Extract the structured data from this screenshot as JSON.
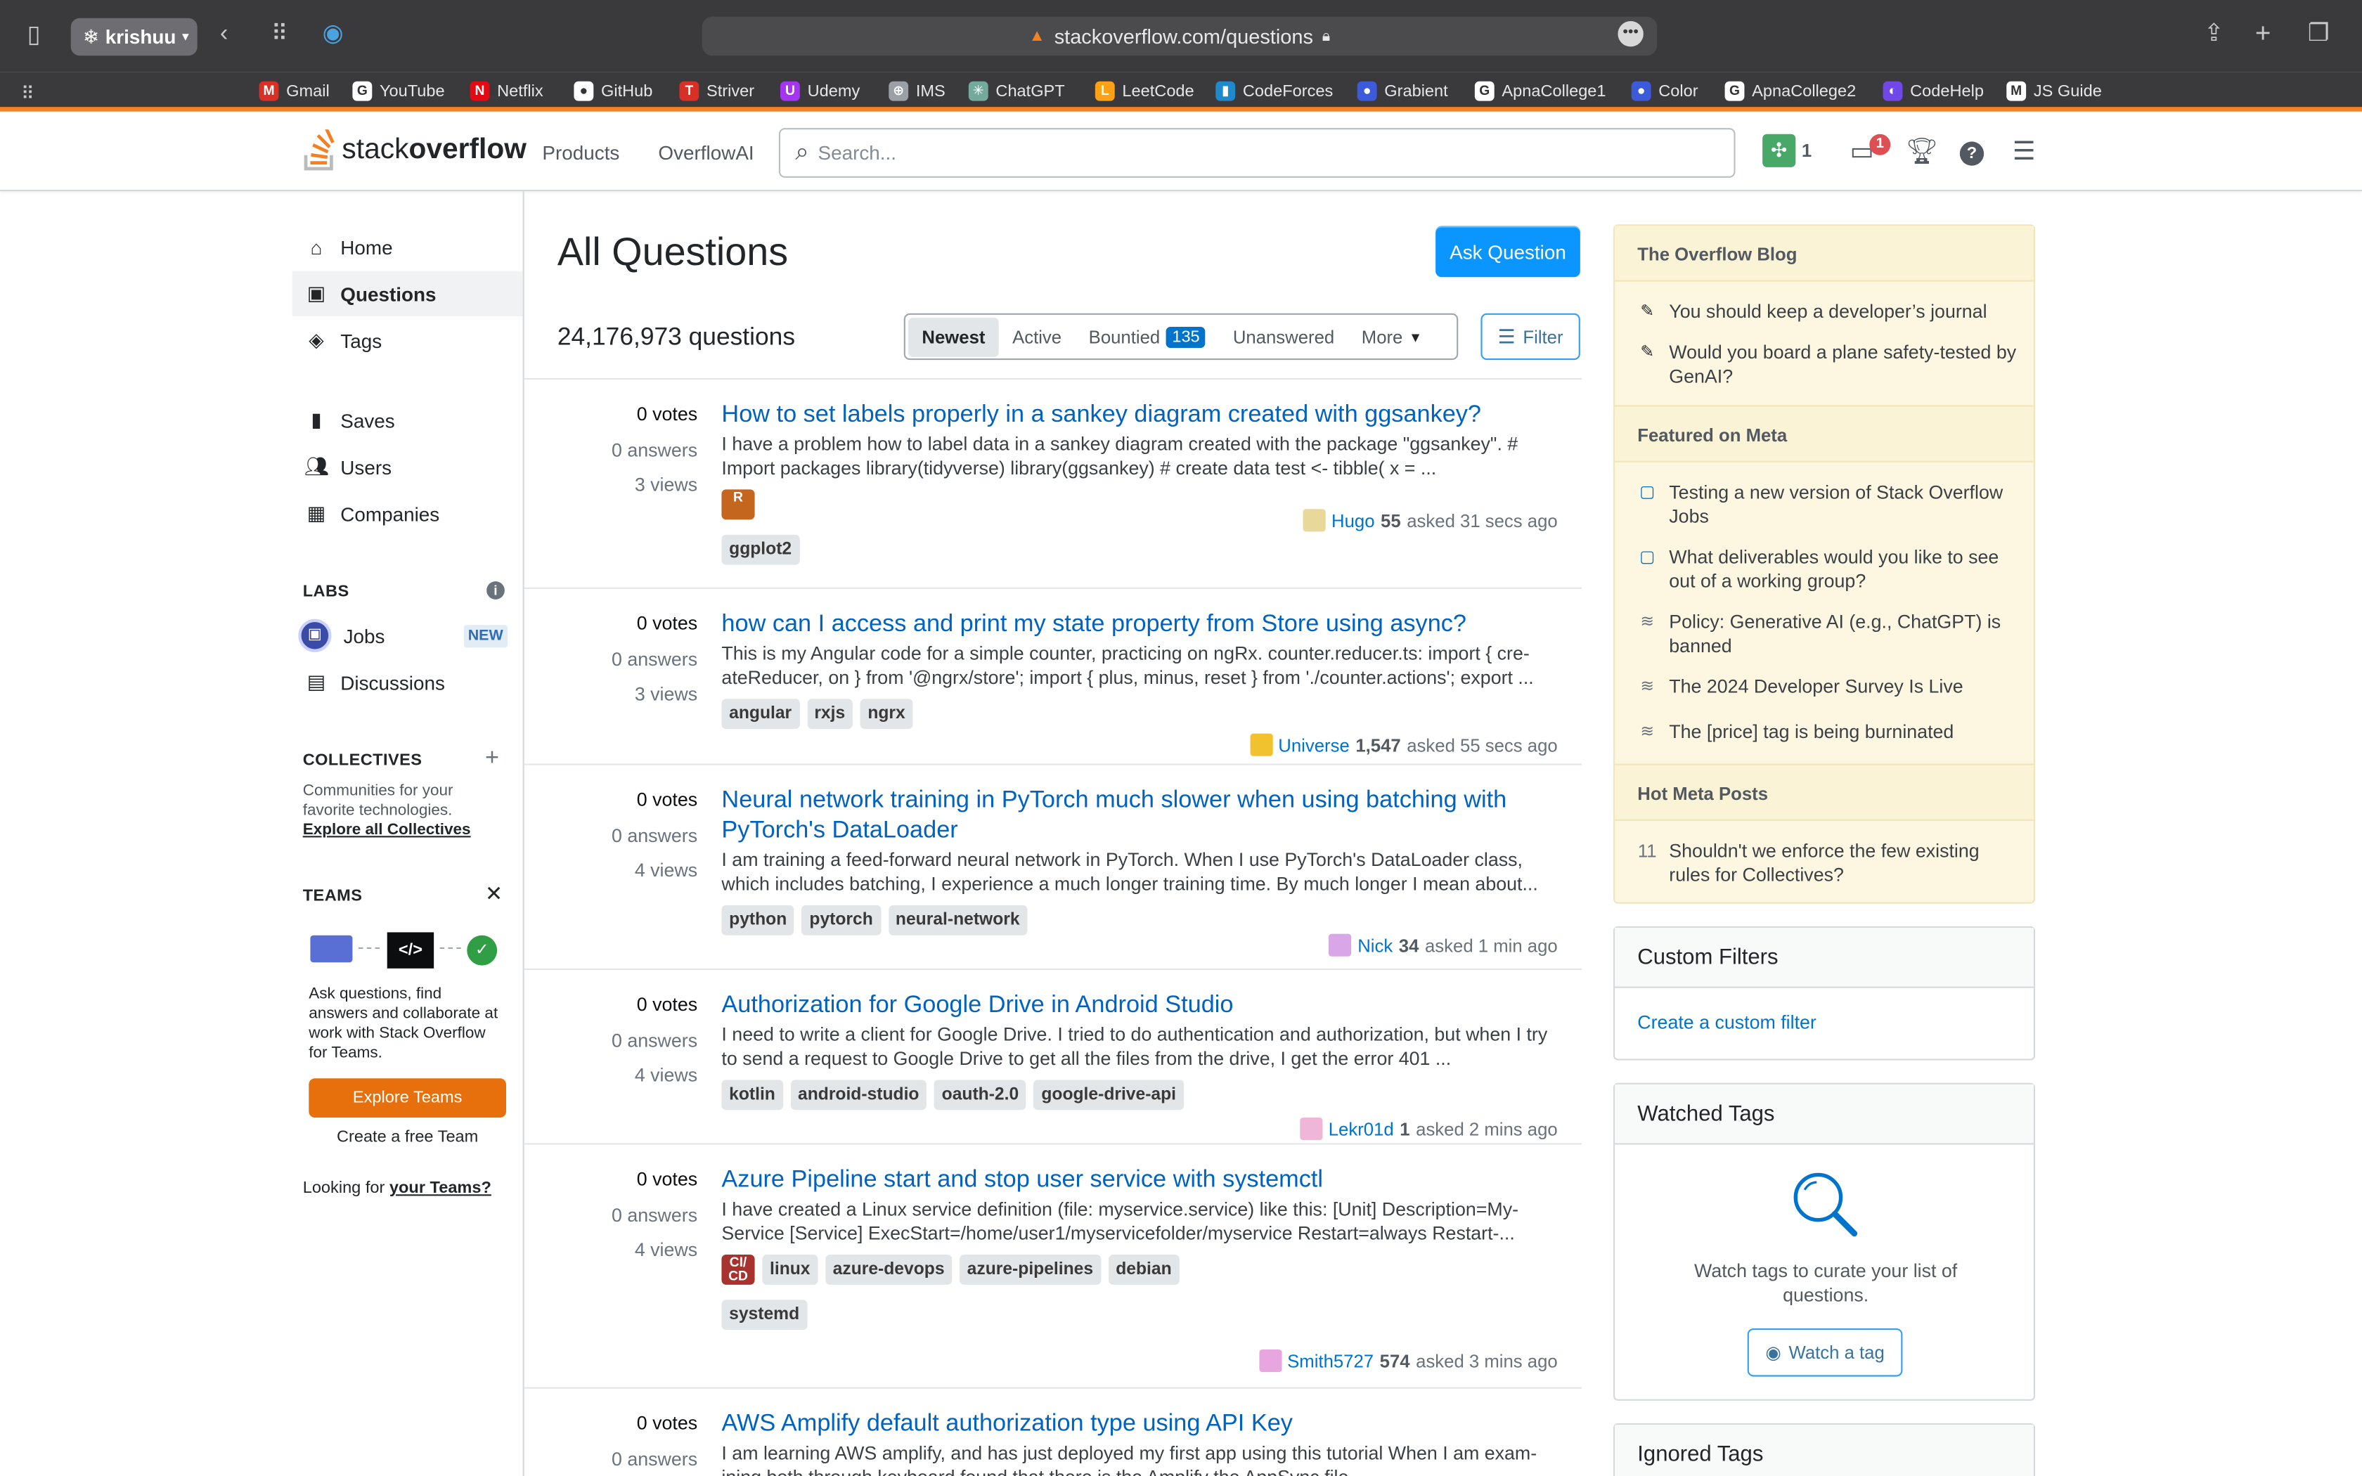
{
  "browser": {
    "profile": "krishuu",
    "url": "stackoverflow.com/questions",
    "bookmarks": [
      {
        "label": "Gmail",
        "color": "#d93025",
        "glyph": "M"
      },
      {
        "label": "YouTube",
        "color": "#ffffff",
        "glyph": "G"
      },
      {
        "label": "Netflix",
        "color": "#e50914",
        "glyph": "N"
      },
      {
        "label": "GitHub",
        "color": "#ffffff",
        "glyph": "●"
      },
      {
        "label": "Striver",
        "color": "#d93025",
        "glyph": "T"
      },
      {
        "label": "Udemy",
        "color": "#a435f0",
        "glyph": "U"
      },
      {
        "label": "IMS",
        "color": "#9aa0a6",
        "glyph": "⊕"
      },
      {
        "label": "ChatGPT",
        "color": "#74aa9c",
        "glyph": "✳"
      },
      {
        "label": "LeetCode",
        "color": "#ffa116",
        "glyph": "L"
      },
      {
        "label": "CodeForces",
        "color": "#1f8acb",
        "glyph": "▮"
      },
      {
        "label": "Grabient",
        "color": "#3b5bdb",
        "glyph": "●"
      },
      {
        "label": "ApnaCollege1",
        "color": "#ffffff",
        "glyph": "G"
      },
      {
        "label": "Color",
        "color": "#3b5bdb",
        "glyph": "●"
      },
      {
        "label": "ApnaCollege2",
        "color": "#ffffff",
        "glyph": "G"
      },
      {
        "label": "CodeHelp",
        "color": "#7048e8",
        "glyph": "◐"
      },
      {
        "label": "JS Guide",
        "color": "#ffffff",
        "glyph": "M"
      }
    ]
  },
  "header": {
    "logo_light": "stack",
    "logo_bold": "overflow",
    "nav": [
      "Products",
      "OverflowAI"
    ],
    "search_placeholder": "Search...",
    "reputation": "1",
    "inbox_count": "1"
  },
  "sidebar": {
    "items": [
      {
        "label": "Home",
        "icon": "home-icon"
      },
      {
        "label": "Questions",
        "icon": "questions-icon"
      },
      {
        "label": "Tags",
        "icon": "tag-icon"
      },
      {
        "label": "Saves",
        "icon": "bookmark-icon"
      },
      {
        "label": "Users",
        "icon": "users-icon"
      },
      {
        "label": "Companies",
        "icon": "companies-icon"
      }
    ],
    "labs_title": "LABS",
    "labs_items": [
      {
        "label": "Jobs",
        "badge": "NEW"
      },
      {
        "label": "Discussions"
      }
    ],
    "collectives_title": "COLLECTIVES",
    "collectives_desc": "Communities for your favorite technologies.",
    "collectives_link": "Explore all Collectives",
    "teams_title": "TEAMS",
    "teams_desc": "Ask questions, find answers and collaborate at work with Stack Overflow for Teams.",
    "teams_btn": "Explore Teams",
    "teams_free": "Create a free Team",
    "teams_looking": "Looking for",
    "teams_link": "your Teams?"
  },
  "main": {
    "title": "All Questions",
    "ask_button": "Ask Question",
    "question_count": "24,176,973 questions",
    "tabs": [
      {
        "label": "Newest"
      },
      {
        "label": "Active"
      },
      {
        "label": "Bountied",
        "badge": "135"
      },
      {
        "label": "Unanswered"
      },
      {
        "label": "More"
      }
    ],
    "filter": "Filter",
    "questions": [
      {
        "votes": "0",
        "votes_label": "votes",
        "answers": "0 answers",
        "views": "3 views",
        "title": "How to set labels properly in a sankey diagram created with ggsankey?",
        "excerpt": "I have a problem how to label data in a sankey diagram created with the package \"ggsankey\". # Import packages library(tidyverse) library(ggsankey) # create data test <- tibble( x = ...",
        "collective": "R",
        "collective_color": "#c5661f",
        "tags": [
          "ggplot2"
        ],
        "user": "Hugo",
        "rep": "55",
        "time": "asked 31 secs ago",
        "avatar_color": "#e8d89a"
      },
      {
        "votes": "0",
        "votes_label": "votes",
        "answers": "0 answers",
        "views": "3 views",
        "title": "how can I access and print my state property from Store using async?",
        "excerpt": "This is my Angular code for a simple counter, practicing on ngRx. counter.reducer.ts: import { cre-ateReducer, on } from '@ngrx/store'; import { plus, minus, reset } from './counter.actions'; export ...",
        "collective": "",
        "collective_color": "",
        "tags": [
          "angular",
          "rxjs",
          "ngrx"
        ],
        "user": "Universe",
        "rep": "1,547",
        "time": "asked 55 secs ago",
        "avatar_color": "#f2c12e"
      },
      {
        "votes": "0",
        "votes_label": "votes",
        "answers": "0 answers",
        "views": "4 views",
        "title": "Neural network training in PyTorch much slower when using batching with PyTorch's DataLoader",
        "excerpt": "I am training a feed-forward neural network in PyTorch. When I use PyTorch's DataLoader class, which includes batching, I experience a much longer training time. By much longer I mean about...",
        "collective": "",
        "collective_color": "",
        "tags": [
          "python",
          "pytorch",
          "neural-network"
        ],
        "user": "Nick",
        "rep": "34",
        "time": "asked 1 min ago",
        "avatar_color": "#d9a6e8"
      },
      {
        "votes": "0",
        "votes_label": "votes",
        "answers": "0 answers",
        "views": "4 views",
        "title": "Authorization for Google Drive in Android Studio",
        "excerpt": "I need to write a client for Google Drive. I tried to do authentication and authorization, but when I try to send a request to Google Drive to get all the files from the drive, I get the error 401 ...",
        "collective": "",
        "collective_color": "",
        "tags": [
          "kotlin",
          "android-studio",
          "oauth-2.0",
          "google-drive-api"
        ],
        "user": "Lekr01d",
        "rep": "1",
        "time": "asked 2 mins ago",
        "avatar_color": "#f0b6d8"
      },
      {
        "votes": "0",
        "votes_label": "votes",
        "answers": "0 answers",
        "views": "4 views",
        "title": "Azure Pipeline start and stop user service with systemctl",
        "excerpt": "I have created a Linux service definition (file: myservice.service) like this: [Unit] Description=My-Service [Service] ExecStart=/home/user1/myservicefolder/myservice Restart=always Restart-...",
        "collective": "CI/ CD",
        "collective_color": "#a8322e",
        "tags": [
          "linux",
          "azure-devops",
          "azure-pipelines",
          "debian",
          "systemd"
        ],
        "user": "Smith5727",
        "rep": "574",
        "time": "asked 3 mins ago",
        "avatar_color": "#e8a6e0"
      },
      {
        "votes": "0",
        "votes_label": "votes",
        "answers": "0 answers",
        "views": "",
        "title": "AWS Amplify default authorization type using API Key",
        "excerpt": "I am learning AWS amplify, and has just deployed my first app using this tutorial When I am exam-ining both through keyboard found that there is the Amplify the AppSync file",
        "collective": "",
        "collective_color": "",
        "tags": [],
        "user": "",
        "rep": "",
        "time": "",
        "avatar_color": ""
      }
    ]
  },
  "right": {
    "blog_title": "The Overflow Blog",
    "blog_items": [
      "You should keep a developer’s journal",
      "Would you board a plane safety-tested by GenAI?"
    ],
    "meta_title": "Featured on Meta",
    "meta_items": [
      "Testing a new version of Stack Overflow Jobs",
      "What deliverables would you like to see out of a working group?",
      "Policy: Generative AI (e.g., ChatGPT) is banned",
      "The 2024 Developer Survey Is Live",
      "The [price] tag is being burninated"
    ],
    "hot_title": "Hot Meta Posts",
    "hot_items": [
      {
        "count": "11",
        "text": "Shouldn't we enforce the few existing rules for Collectives?"
      }
    ],
    "custom_filters_title": "Custom Filters",
    "custom_filters_link": "Create a custom filter",
    "watched_title": "Watched Tags",
    "watched_text": "Watch tags to curate your list of questions.",
    "watched_btn": "Watch a tag",
    "ignored_title": "Ignored Tags"
  }
}
